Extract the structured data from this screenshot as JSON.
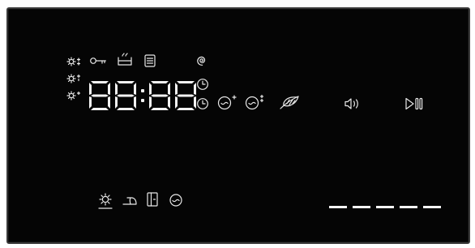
{
  "display": {
    "time_digits": [
      "8",
      "8",
      "8",
      "8"
    ],
    "time_separator": ":",
    "colors": {
      "panel_background": "#050505",
      "indicator": "#e8e8e8",
      "frame": "#3a3a3a"
    }
  },
  "indicators": {
    "temperature_levels": [
      "temp-high-icon",
      "temp-medium-icon",
      "temp-low-icon"
    ],
    "top_row": [
      "door-lock-key-icon",
      "prewash-basin-icon",
      "detergent-drawer-icon",
      "spin-spiral-icon"
    ],
    "clock_icons": [
      "delay-clock-icon",
      "finish-clock-icon"
    ],
    "options": [
      "extra-rinse-icon",
      "extra-rinse-plus-icon",
      "feather-soft-icon"
    ],
    "bottom_row": [
      "sun-dry-icon",
      "iron-easy-care-icon",
      "door-indicator-icon",
      "drum-icon"
    ]
  },
  "controls": {
    "sound_icon": "speaker-sound-icon",
    "play_pause_icon": "play-pause-icon"
  },
  "progress": {
    "segments_total": 5,
    "segments_lit": 5
  }
}
